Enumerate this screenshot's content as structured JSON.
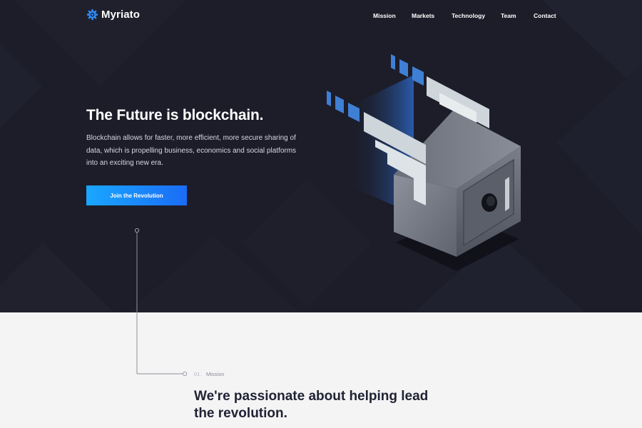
{
  "brand": {
    "name": "Myriato",
    "logo_icon": "gear-icon"
  },
  "nav": {
    "items": [
      {
        "label": "Mission"
      },
      {
        "label": "Markets"
      },
      {
        "label": "Technology"
      },
      {
        "label": "Team"
      },
      {
        "label": "Contact"
      }
    ]
  },
  "hero": {
    "title": "The Future is blockchain.",
    "description": "Blockchain allows for faster, more efficient, more secure sharing of data, which is propelling business, economics and social platforms into an exciting new era.",
    "cta_label": "Join the Revolution",
    "illustration": "winged-safe-icon"
  },
  "mission": {
    "number": "01.",
    "label": "Mission",
    "title": "We're passionate about helping lead the revolution."
  },
  "colors": {
    "hero_bg": "#1c1d29",
    "accent_start": "#1aa7ff",
    "accent_end": "#1a6cf5",
    "page_bg": "#f4f4f5",
    "heading_dark": "#1f2233"
  }
}
